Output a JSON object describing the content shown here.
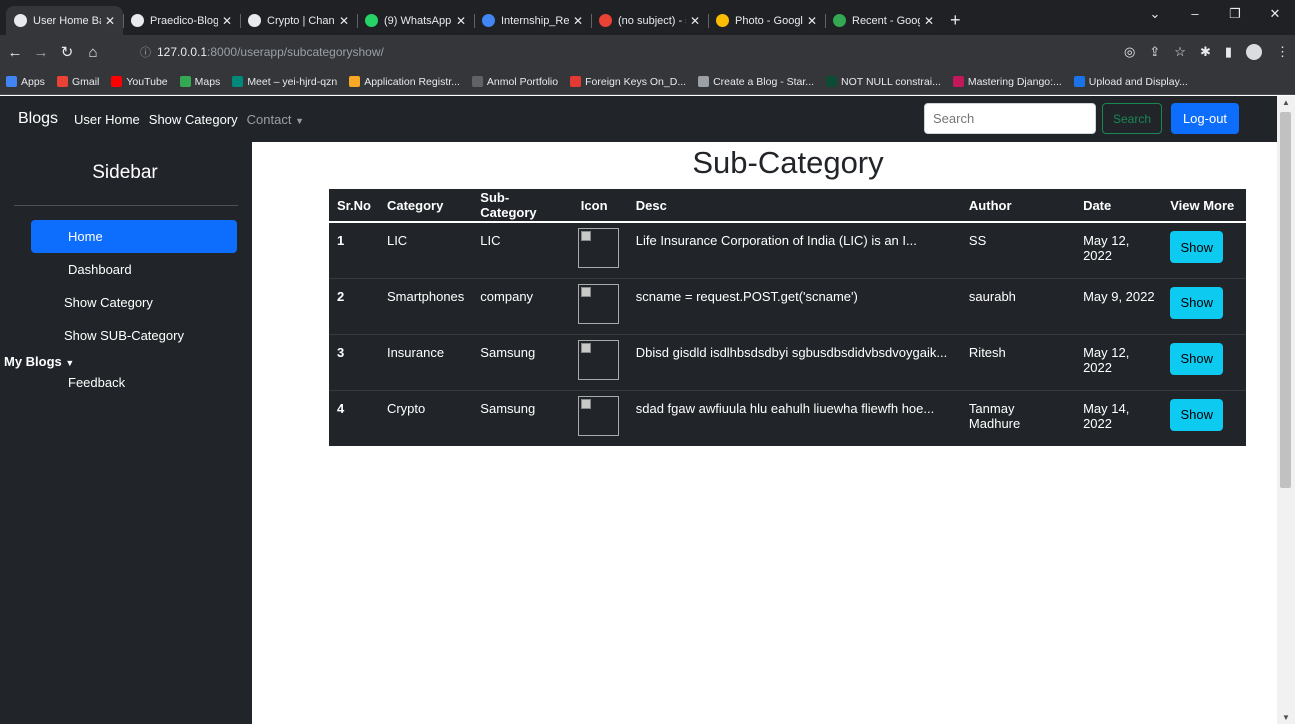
{
  "browser": {
    "tabs": [
      {
        "label": "User Home Base",
        "color": "#e8eaed",
        "active": true
      },
      {
        "label": "Praedico-Blogs-",
        "color": "#e8eaed"
      },
      {
        "label": "Crypto | Change",
        "color": "#e8eaed"
      },
      {
        "label": "(9) WhatsApp",
        "color": "#25d366"
      },
      {
        "label": "Internship_Repor",
        "color": "#4285f4"
      },
      {
        "label": "(no subject) - sau",
        "color": "#ea4335"
      },
      {
        "label": "Photo - Google P",
        "color": "#fbbc04"
      },
      {
        "label": "Recent - Google D",
        "color": "#34a853"
      }
    ],
    "new_tab": "+",
    "url_host": "127.0.0.1",
    "url_path": ":8000/userapp/subcategoryshow/",
    "bookmarks": [
      {
        "label": "Apps",
        "color": "#4285f4"
      },
      {
        "label": "Gmail",
        "color": "#ea4335"
      },
      {
        "label": "YouTube",
        "color": "#ff0000"
      },
      {
        "label": "Maps",
        "color": "#34a853"
      },
      {
        "label": "Meet – yei-hjrd-qzn",
        "color": "#00897b"
      },
      {
        "label": "Application Registr...",
        "color": "#f9a825"
      },
      {
        "label": "Anmol Portfolio",
        "color": "#5f6368"
      },
      {
        "label": "Foreign Keys On_D...",
        "color": "#e53935"
      },
      {
        "label": "Create a Blog - Star...",
        "color": "#9aa0a6"
      },
      {
        "label": "NOT NULL constrai...",
        "color": "#0c4b33"
      },
      {
        "label": "Mastering Django:...",
        "color": "#c2185b"
      },
      {
        "label": "Upload and Display...",
        "color": "#1a73e8"
      }
    ]
  },
  "navbar": {
    "brand": "Blogs",
    "links": [
      "User Home",
      "Show Category"
    ],
    "contact": "Contact",
    "search_placeholder": "Search",
    "search_button": "Search",
    "logout_button": "Log-out",
    "colors": {
      "primary": "#0d6efd",
      "success": "#198754",
      "dark": "#212529"
    }
  },
  "sidebar": {
    "title": "Sidebar",
    "items": [
      "Home",
      "Dashboard",
      "Show Category",
      "Show SUB-Category"
    ],
    "my_blogs": "My Blogs",
    "feedback": "Feedback"
  },
  "main": {
    "title": "Sub-Category",
    "columns": [
      "Sr.No",
      "Category",
      "Sub-Category",
      "Icon",
      "Desc",
      "Author",
      "Date",
      "View More"
    ],
    "rows": [
      {
        "srno": "1",
        "category": "LIC",
        "subcategory": "LIC",
        "desc": "Life Insurance Corporation of India (LIC) is an I...",
        "author": "SS",
        "date": "May 12, 2022",
        "action": "Show"
      },
      {
        "srno": "2",
        "category": "Smartphones",
        "subcategory": "company",
        "desc": "scname = request.POST.get('scname')",
        "author": "saurabh",
        "date": "May 9, 2022",
        "action": "Show"
      },
      {
        "srno": "3",
        "category": "Insurance",
        "subcategory": "Samsung",
        "desc": "Dbisd gisdld isdlhbsdsdbyi sgbusdbsdidvbsdvoygaik...",
        "author": "Ritesh",
        "date": "May 12, 2022",
        "action": "Show"
      },
      {
        "srno": "4",
        "category": "Crypto",
        "subcategory": "Samsung",
        "desc": "sdad fgaw awfiuula hlu eahulh liuewha fliewfh hoe...",
        "author": "Tanmay Madhure",
        "date": "May 14, 2022",
        "action": "Show"
      }
    ],
    "show_button_color": "#0dcaf0"
  }
}
